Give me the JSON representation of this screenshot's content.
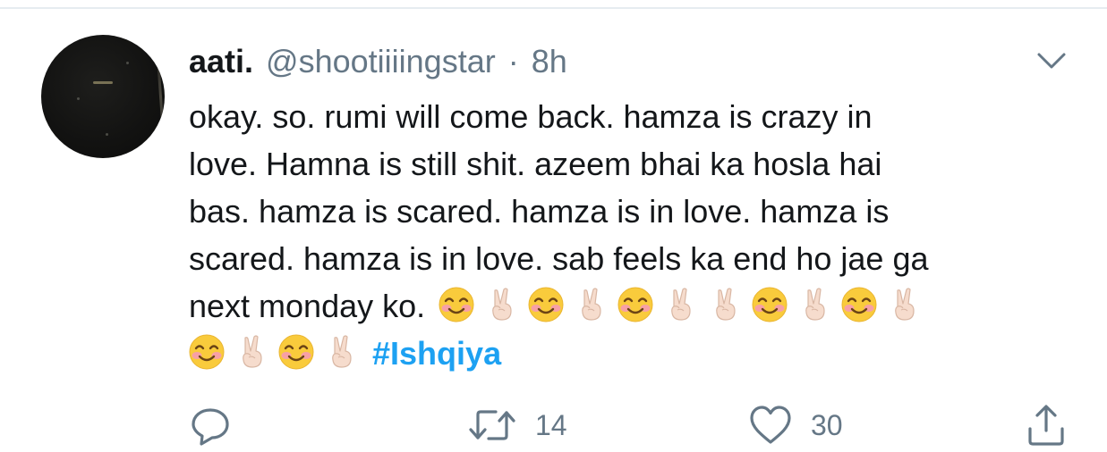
{
  "tweet": {
    "display_name": "aati.",
    "handle": "@shootiiiingstar",
    "separator": "·",
    "time": "8h",
    "text_lines": [
      "okay. so. rumi will come back. hamza is crazy in",
      "love. Hamna is still shit. azeem bhai ka hosla hai",
      "bas. hamza is scared. hamza is in love. hamza is",
      "scared. hamza is in love. sab feels ka end ho jae ga"
    ],
    "line5_text": "next monday ko.",
    "hashtag": "#Ishqiya",
    "emoji_sequence_line5": [
      "smiling-face-with-smiling-eyes",
      "victory-hand",
      "smiling-face-with-smiling-eyes",
      "victory-hand",
      "smiling-face-with-smiling-eyes",
      "victory-hand",
      "victory-hand",
      "smiling-face-with-smiling-eyes",
      "victory-hand",
      "smiling-face-with-smiling-eyes",
      "victory-hand"
    ],
    "emoji_sequence_line6": [
      "smiling-face-with-smiling-eyes",
      "victory-hand",
      "smiling-face-with-smiling-eyes",
      "victory-hand"
    ]
  },
  "actions": {
    "reply_icon": "reply-icon",
    "retweet_icon": "retweet-icon",
    "retweet_count": "14",
    "like_icon": "heart-icon",
    "like_count": "30",
    "share_icon": "share-icon"
  },
  "colors": {
    "text": "#14171a",
    "secondary": "#657786",
    "link": "#1da1f2",
    "divider": "#e6ecf0"
  }
}
